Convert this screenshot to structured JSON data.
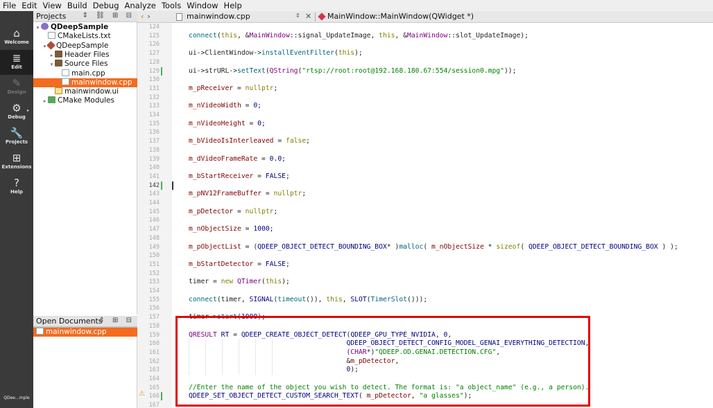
{
  "menu": [
    "File",
    "Edit",
    "View",
    "Build",
    "Debug",
    "Analyze",
    "Tools",
    "Window",
    "Help"
  ],
  "modes": [
    {
      "label": "Welcome",
      "icon": "⌂"
    },
    {
      "label": "Edit",
      "icon": "≣"
    },
    {
      "label": "Design",
      "icon": "✎"
    },
    {
      "label": "Debug",
      "icon": "⚙"
    },
    {
      "label": "Projects",
      "icon": "🔧"
    },
    {
      "label": "Extensions",
      "icon": "⊞"
    },
    {
      "label": "Help",
      "icon": "?"
    }
  ],
  "target_label": "QDee...mple",
  "projects": {
    "title": "Projects",
    "tree": [
      {
        "label": "QDeepSample",
        "icon": "proj",
        "twisty": "▾",
        "indent": 0,
        "bold": true
      },
      {
        "label": "CMakeLists.txt",
        "icon": "txt",
        "twisty": "",
        "indent": 1
      },
      {
        "label": "QDeepSample",
        "icon": "hammer",
        "twisty": "▾",
        "indent": 1
      },
      {
        "label": "Header Files",
        "icon": "folder",
        "twisty": "▸",
        "indent": 2
      },
      {
        "label": "Source Files",
        "icon": "folder",
        "twisty": "▾",
        "indent": 2
      },
      {
        "label": "main.cpp",
        "icon": "cpp",
        "twisty": "",
        "indent": 3
      },
      {
        "label": "mainwindow.cpp",
        "icon": "cpp",
        "twisty": "",
        "indent": 3,
        "selected": true
      },
      {
        "label": "mainwindow.ui",
        "icon": "ui",
        "twisty": "",
        "indent": 2
      },
      {
        "label": "CMake Modules",
        "icon": "cmake",
        "twisty": "▸",
        "indent": 1
      }
    ]
  },
  "open_documents": {
    "title": "Open Documents",
    "items": [
      {
        "label": "mainwindow.cpp",
        "selected": true
      }
    ]
  },
  "editor": {
    "file": "mainwindow.cpp",
    "symbol": "MainWindow::MainWindow(QWidget *)",
    "current_line": 142,
    "lines": [
      {
        "n": 124,
        "code": ""
      },
      {
        "n": 125,
        "code": "connect(this, &MainWindow::signal_UpdateImage, this, &MainWindow::slot_UpdateImage);"
      },
      {
        "n": 126,
        "code": ""
      },
      {
        "n": 127,
        "code": "ui->ClientWindow->installEventFilter(this);"
      },
      {
        "n": 128,
        "code": ""
      },
      {
        "n": 129,
        "code": "ui->strURL->setText(QString(\"rtsp://root:root@192.168.180.67:554/session0.mpg\"));"
      },
      {
        "n": 130,
        "code": ""
      },
      {
        "n": 131,
        "code": "m_pReceiver = nullptr;"
      },
      {
        "n": 132,
        "code": ""
      },
      {
        "n": 133,
        "code": "m_nVideoWidth = 0;"
      },
      {
        "n": 134,
        "code": ""
      },
      {
        "n": 135,
        "code": "m_nVideoHeight = 0;"
      },
      {
        "n": 136,
        "code": ""
      },
      {
        "n": 137,
        "code": "m_bVideoIsInterleaved = false;"
      },
      {
        "n": 138,
        "code": ""
      },
      {
        "n": 139,
        "code": "m_dVideoFrameRate = 0.0;"
      },
      {
        "n": 140,
        "code": ""
      },
      {
        "n": 141,
        "code": "m_bStartReceiver = FALSE;"
      },
      {
        "n": 142,
        "code": ""
      },
      {
        "n": 143,
        "code": "m_pNV12FrameBuffer = nullptr;"
      },
      {
        "n": 144,
        "code": ""
      },
      {
        "n": 145,
        "code": "m_pDetector = nullptr;"
      },
      {
        "n": 146,
        "code": ""
      },
      {
        "n": 147,
        "code": "m_nObjectSize = 1000;"
      },
      {
        "n": 148,
        "code": ""
      },
      {
        "n": 149,
        "code": "m_pObjectList = (QDEEP_OBJECT_DETECT_BOUNDING_BOX* )malloc( m_nObjectSize * sizeof( QDEEP_OBJECT_DETECT_BOUNDING_BOX ) );"
      },
      {
        "n": 150,
        "code": ""
      },
      {
        "n": 151,
        "code": "m_bStartDetector = FALSE;"
      },
      {
        "n": 152,
        "code": ""
      },
      {
        "n": 153,
        "code": "timer = new QTimer(this);"
      },
      {
        "n": 154,
        "code": ""
      },
      {
        "n": 155,
        "code": "connect(timer, SIGNAL(timeout()), this, SLOT(TimerSlot()));"
      },
      {
        "n": 156,
        "code": ""
      },
      {
        "n": 157,
        "code": "timer->start(1000);"
      },
      {
        "n": 158,
        "code": ""
      },
      {
        "n": 159,
        "code": "QRESULT RT = QDEEP_CREATE_OBJECT_DETECT(QDEEP_GPU_TYPE_NVIDIA, 0,"
      },
      {
        "n": 160,
        "code": "                                       QDEEP_OBJECT_DETECT_CONFIG_MODEL_GENAI_EVERYTHING_DETECTION,"
      },
      {
        "n": 161,
        "code": "                                       (CHAR*)\"QDEEP.OD.GENAI.DETECTION.CFG\","
      },
      {
        "n": 162,
        "code": "                                       &m_pDetector,"
      },
      {
        "n": 163,
        "code": "                                       0);"
      },
      {
        "n": 164,
        "code": ""
      },
      {
        "n": 165,
        "code": "//Enter the name of the object you wish to detect. The format is: \"a object_name\" (e.g., a person)."
      },
      {
        "n": 166,
        "code": "QDEEP_SET_OBJECT_DETECT_CUSTOM_SEARCH_TEXT( m_pDetector, \"a glasses\");"
      },
      {
        "n": 167,
        "code": ""
      }
    ]
  },
  "colors": {
    "accent_selection": "#f36c20",
    "highlight_box": "#e00000",
    "modebar": "#3a3a3a"
  }
}
